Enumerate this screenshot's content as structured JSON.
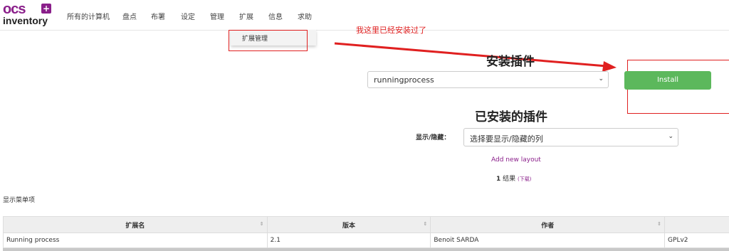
{
  "header": {
    "logo_top": "ocs",
    "logo_bottom": "inventory",
    "nav": [
      "所有的计算机",
      "盘点",
      "布署",
      "设定",
      "管理",
      "扩展",
      "信息",
      "求助"
    ],
    "dropdown_item": "扩展管理"
  },
  "annotation": "我这里已经安装过了",
  "install": {
    "title": "安装插件",
    "select_value": "runningprocess",
    "button": "Install"
  },
  "installed": {
    "title": "已安装的插件",
    "show_label": "显示/隐藏：",
    "select_placeholder": "选择要显示/隐藏的列",
    "add_layout": "Add new layout",
    "result_count": "1",
    "result_text": " 结果 ",
    "download": "(下载)"
  },
  "menu_label": "显示菜单项",
  "table": {
    "headers": [
      "扩展名",
      "版本",
      "作者",
      ""
    ],
    "rows": [
      [
        "Running process",
        "2.1",
        "Benoit SARDA",
        "GPLv2"
      ]
    ]
  },
  "colors": {
    "brand": "#8a1f8a",
    "install_button": "#5cb85c",
    "annotation": "#e02020"
  }
}
